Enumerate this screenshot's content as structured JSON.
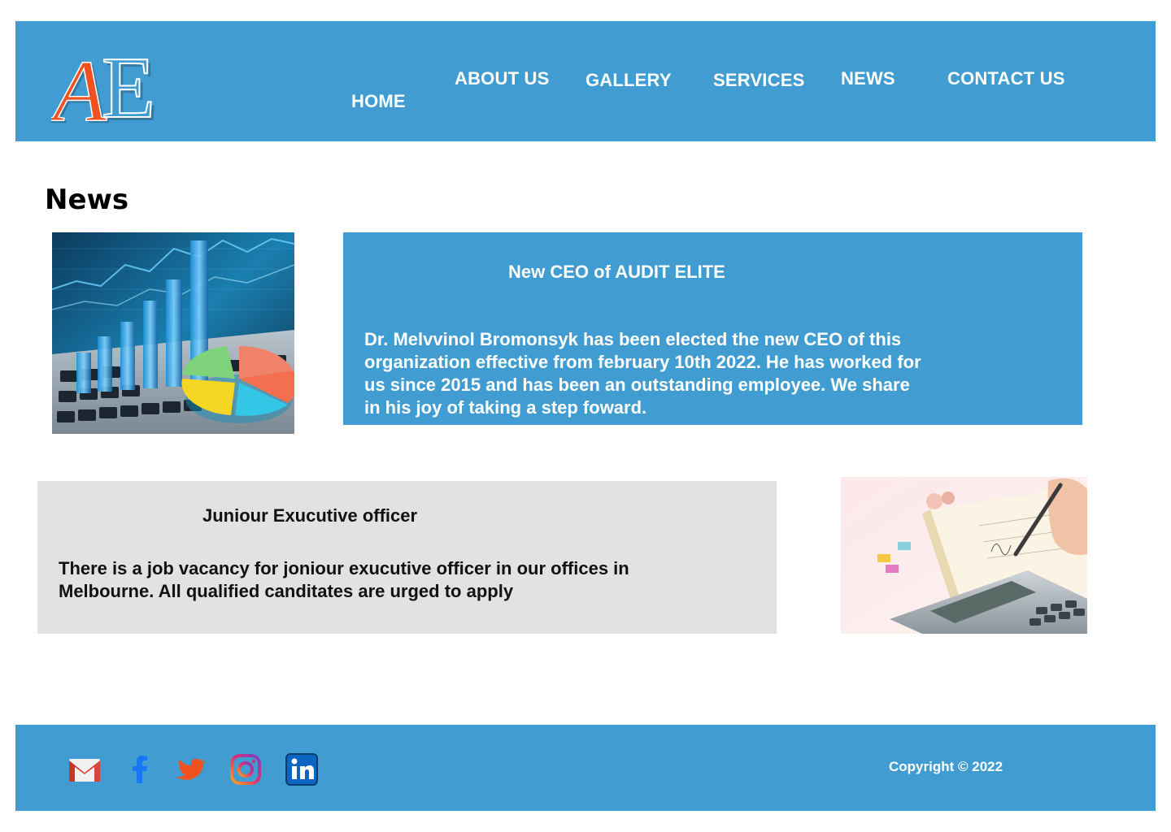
{
  "brand": {
    "logo_letters": "AE",
    "colors": {
      "header_bg": "#419dd1",
      "logo_a": "#f0511f",
      "card_grey": "#e2e2e2"
    }
  },
  "nav": {
    "home": "HOME",
    "about": "ABOUT US",
    "gallery": "GALLERY",
    "services": "SERVICES",
    "news": "NEWS",
    "contact": "CONTACT US"
  },
  "main": {
    "title": "News",
    "articles": [
      {
        "title": "New CEO of AUDIT ELITE",
        "body": "Dr. Melvvinol Bromonsyk has been elected the new CEO of this organization effective from february 10th 2022. He has worked for us since 2015 and has been an outstanding employee. We share in his joy of taking a step foward.",
        "image_icon": "finance-chart-image"
      },
      {
        "title": "Juniour  Exucutive officer",
        "body": "There is a job vacancy for joniour exucutive officer in our offices in Melbourne. All qualified canditates are urged to apply",
        "image_icon": "accounting-calculator-image"
      }
    ]
  },
  "footer": {
    "social_icons": [
      "gmail-icon",
      "facebook-icon",
      "twitter-icon",
      "instagram-icon",
      "linkedin-icon"
    ],
    "copyright": "Copyright © 2022"
  }
}
